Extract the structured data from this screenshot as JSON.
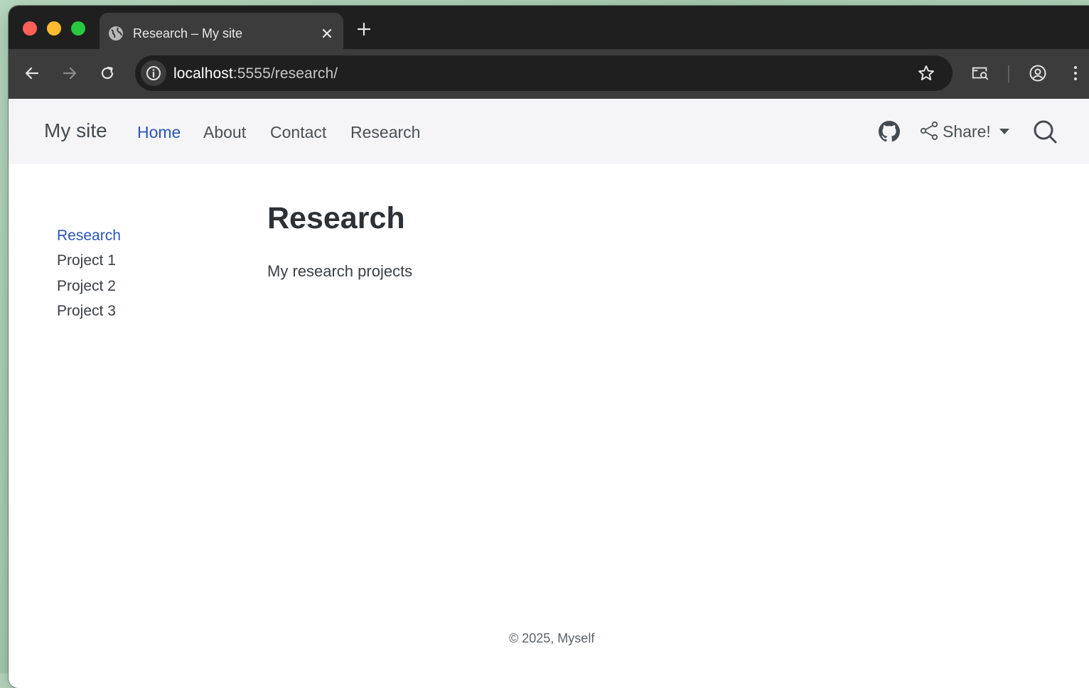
{
  "browser": {
    "tab_title": "Research – My site",
    "url_host": "localhost",
    "url_rest": ":5555/research/",
    "icons": [
      "globe-icon",
      "close-icon",
      "plus-icon",
      "back-icon",
      "forward-icon",
      "reload-icon",
      "info-icon",
      "star-icon",
      "tab-search-icon",
      "profile-icon",
      "menu-dots-icon"
    ]
  },
  "site": {
    "brand": "My site",
    "nav": [
      "Home",
      "About",
      "Contact",
      "Research"
    ],
    "share_label": "Share!"
  },
  "sidebar": [
    "Research",
    "Project 1",
    "Project 2",
    "Project 3"
  ],
  "main": {
    "title": "Research",
    "lead": "My research projects"
  },
  "footer": "© 2025, Myself",
  "colors": {
    "accent": "#2a55b8",
    "navbar_bg": "#f5f5f8",
    "chrome_dark": "#1f1f1f",
    "chrome_toolbar": "#3c3c3c"
  }
}
